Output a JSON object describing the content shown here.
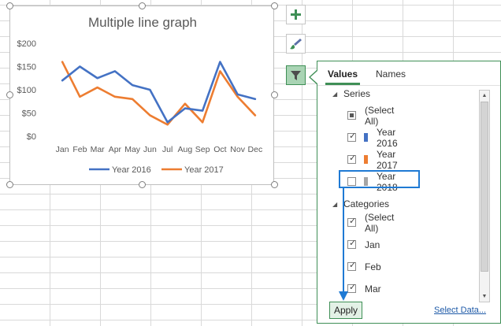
{
  "chart": {
    "title": "Multiple line graph",
    "y_ticks": [
      "$200",
      "$150",
      "$100",
      "$50",
      "$0"
    ],
    "colors": {
      "year2016": "#4472c4",
      "year2017": "#ed7d31",
      "year2018": "#a5a5a5"
    }
  },
  "chart_data": {
    "type": "line",
    "title": "Multiple line graph",
    "categories": [
      "Jan",
      "Feb",
      "Mar",
      "Apr",
      "May",
      "Jun",
      "Jul",
      "Aug",
      "Sep",
      "Oct",
      "Nov",
      "Dec"
    ],
    "ylim": [
      0,
      200
    ],
    "y_ticks": [
      0,
      50,
      100,
      150,
      200
    ],
    "y_format": "currency",
    "grid": false,
    "legend": "bottom",
    "series": [
      {
        "name": "Year 2016",
        "color": "#4472c4",
        "values": [
          120,
          150,
          125,
          140,
          110,
          100,
          30,
          60,
          55,
          160,
          90,
          80
        ]
      },
      {
        "name": "Year 2017",
        "color": "#ed7d31",
        "values": [
          160,
          85,
          105,
          85,
          80,
          45,
          25,
          70,
          30,
          140,
          85,
          45
        ]
      }
    ]
  },
  "side_buttons": [
    {
      "name": "chart-elements-button",
      "icon": "plus-icon"
    },
    {
      "name": "chart-styles-button",
      "icon": "paintbrush-icon"
    },
    {
      "name": "chart-filters-button",
      "icon": "funnel-icon"
    }
  ],
  "panel": {
    "tabs": [
      "Values",
      "Names"
    ],
    "series_header": "Series",
    "series_items": [
      {
        "label": "(Select All)",
        "state": "partial",
        "color": ""
      },
      {
        "label": "Year 2016",
        "state": "checked",
        "color": "#4472c4"
      },
      {
        "label": "Year 2017",
        "state": "checked",
        "color": "#ed7d31"
      },
      {
        "label": "Year 2018",
        "state": "unchecked",
        "color": "#a5a5a5"
      }
    ],
    "categories_header": "Categories",
    "category_items": [
      {
        "label": "(Select All)",
        "state": "checked"
      },
      {
        "label": "Jan",
        "state": "checked"
      },
      {
        "label": "Feb",
        "state": "checked"
      },
      {
        "label": "Mar",
        "state": "checked"
      }
    ],
    "apply_label": "Apply",
    "select_data_label": "Select Data..."
  }
}
